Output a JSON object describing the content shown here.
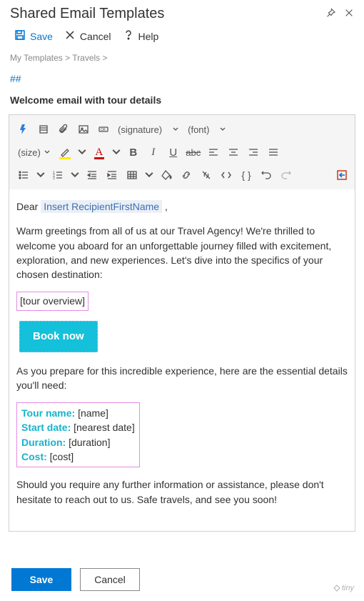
{
  "header": {
    "title": "Shared Email Templates"
  },
  "topbar": {
    "save": "Save",
    "cancel": "Cancel",
    "help": "Help"
  },
  "breadcrumb": "My Templates > Travels >",
  "hash": "##",
  "subject": "Welcome email with tour details",
  "toolbar": {
    "signature": "(signature)",
    "font": "(font)",
    "size": "(size)"
  },
  "body": {
    "dear": "Dear ",
    "insert_field": "Insert RecipientFirstName",
    "dear_comma": " ,",
    "para1": "Warm greetings from all of us at our Travel Agency! We're thrilled to welcome you aboard for an unforgettable journey filled with excitement, exploration, and new experiences. Let's dive into the specifics of your chosen destination:",
    "overview": "[tour overview]",
    "book": "Book now",
    "para2": "As you prepare for this incredible experience, here are the essential details you'll need:",
    "kv": {
      "k1": "Tour name:",
      "v1": " [name]",
      "k2": "Start date:",
      "v2": " [nearest date]",
      "k3": "Duration:",
      "v3": " [duration]",
      "k4": "Cost:",
      "v4": " [cost]"
    },
    "para3": "Should you require any further information or assistance, please don't hesitate to reach out to us. Safe travels, and see you soon!"
  },
  "footer": {
    "save": "Save",
    "cancel": "Cancel",
    "brand": "tiny"
  }
}
